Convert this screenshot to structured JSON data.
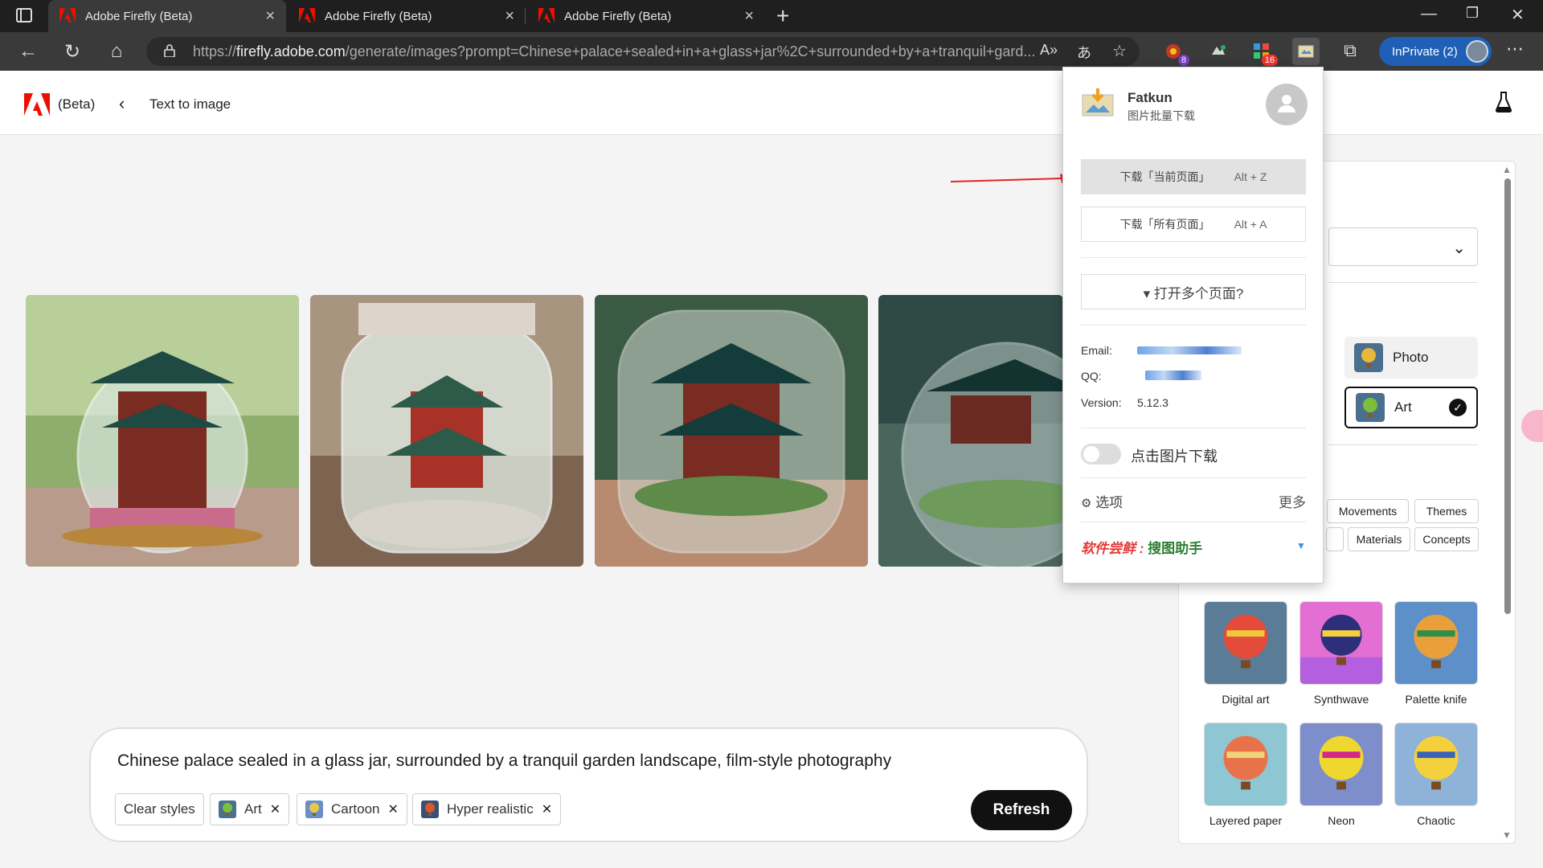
{
  "browser": {
    "tabs": [
      {
        "title": "Adobe Firefly (Beta)",
        "active": true
      },
      {
        "title": "Adobe Firefly (Beta)",
        "active": false
      },
      {
        "title": "Adobe Firefly (Beta)",
        "active": false
      }
    ],
    "url_prefix": "https://",
    "url_host": "firefly.adobe.com",
    "url_rest": "/generate/images?prompt=Chinese+palace+sealed+in+a+glass+jar%2C+surrounded+by+a+tranquil+gard...",
    "extension_badges": {
      "ext1": "8",
      "ext3": "16"
    },
    "profile_label": "InPrivate (2)"
  },
  "header": {
    "beta_label": "(Beta)",
    "page_title": "Text to image"
  },
  "prompt": {
    "text": "Chinese palace sealed in a glass jar, surrounded by a tranquil garden landscape, film-style photography",
    "clear_styles": "Clear styles",
    "chips": [
      "Art",
      "Cartoon",
      "Hyper realistic"
    ],
    "refresh": "Refresh"
  },
  "panel": {
    "content_types": [
      "Photo",
      "Art"
    ],
    "style_tabs": [
      "Movements",
      "Themes",
      "Materials",
      "Concepts"
    ],
    "styles": [
      "Digital art",
      "Synthwave",
      "Palette knife",
      "Layered paper",
      "Neon",
      "Chaotic"
    ]
  },
  "popup": {
    "name": "Fatkun",
    "subtitle": "图片批量下载",
    "btn_current": "下载「当前页面」",
    "btn_current_key": "Alt + Z",
    "btn_all": "下载「所有页面」",
    "btn_all_key": "Alt + A",
    "open_multi": "▾ 打开多个页面?",
    "email_label": "Email:",
    "qq_label": "QQ:",
    "version_label": "Version:",
    "version": "5.12.3",
    "toggle_label": "点击图片下载",
    "options": "选项",
    "more": "更多",
    "promo_prefix": "软件尝鲜 : ",
    "promo_name": "搜图助手"
  },
  "colors": {
    "adobe_red": "#eb1000",
    "inprivate_blue": "#1f5fb5",
    "promo_red": "#e53935",
    "promo_green": "#2e7d32"
  }
}
